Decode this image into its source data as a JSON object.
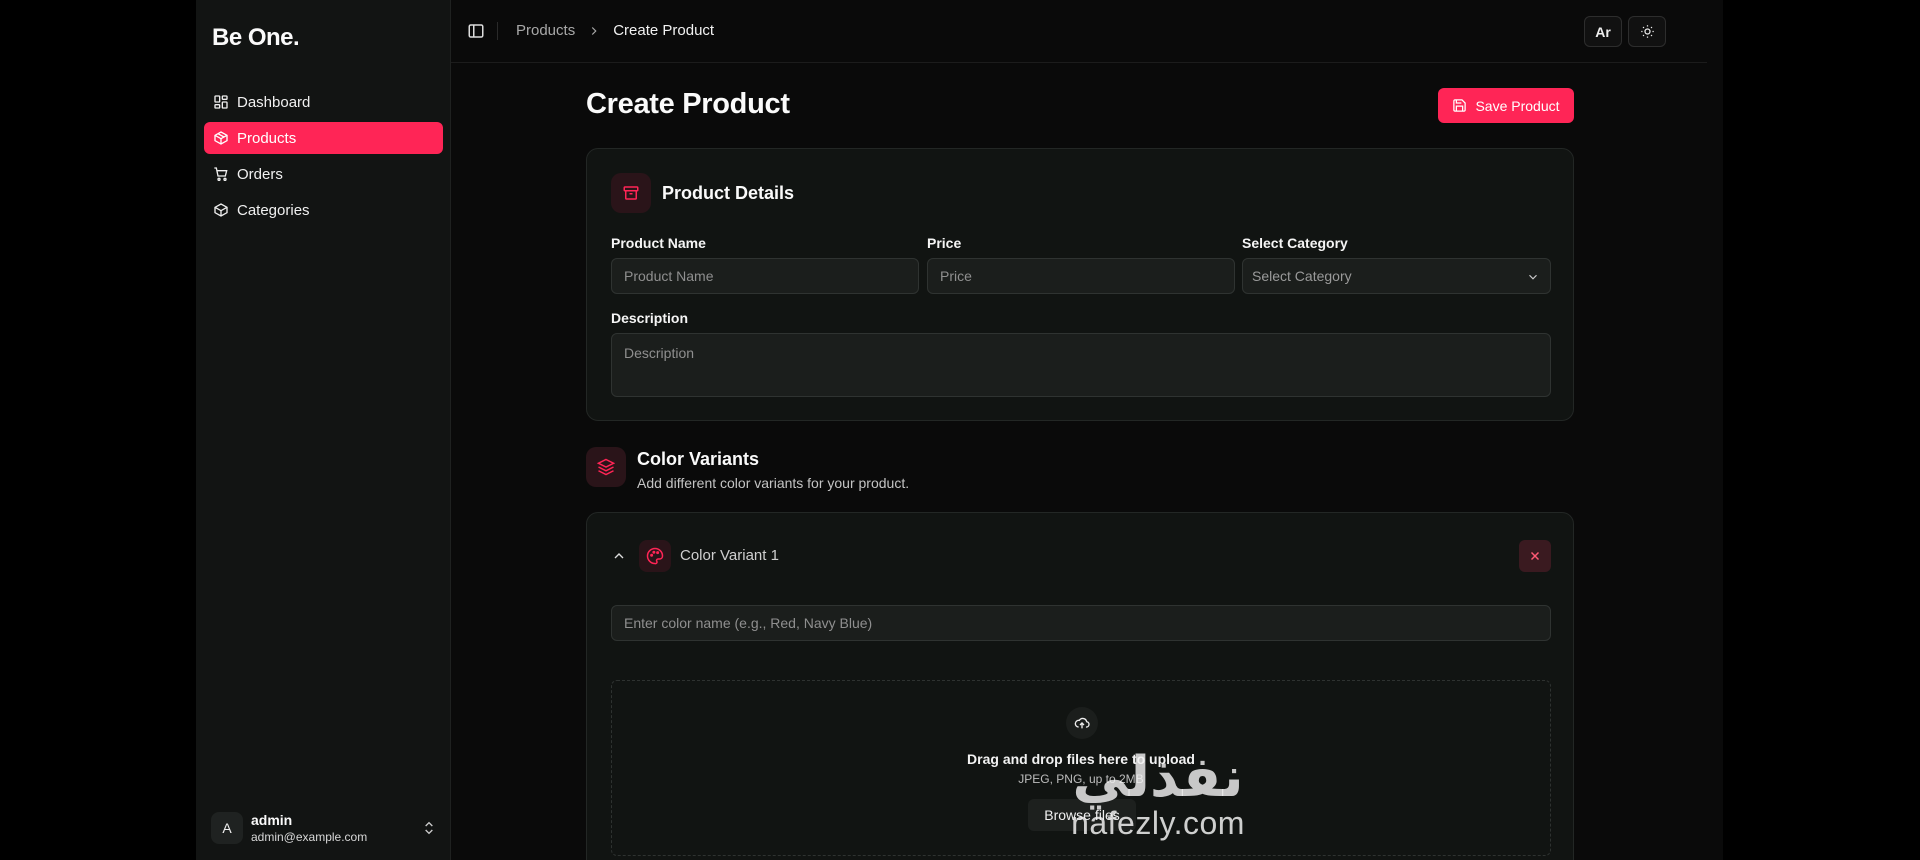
{
  "sidebar": {
    "brand": "Be One.",
    "items": [
      {
        "label": "Dashboard",
        "icon": "dashboard-icon"
      },
      {
        "label": "Products",
        "icon": "package-icon",
        "active": true
      },
      {
        "label": "Orders",
        "icon": "cart-icon"
      },
      {
        "label": "Categories",
        "icon": "box-icon"
      }
    ],
    "user": {
      "initial": "A",
      "name": "admin",
      "email": "admin@example.com"
    }
  },
  "header": {
    "breadcrumb": [
      "Products",
      "Create Product"
    ],
    "lang_button": "Ar",
    "theme_icon": "sun-icon"
  },
  "page": {
    "title": "Create Product",
    "save_label": "Save Product"
  },
  "details": {
    "title": "Product Details",
    "name_label": "Product Name",
    "name_placeholder": "Product Name",
    "price_label": "Price",
    "price_placeholder": "Price",
    "category_label": "Select Category",
    "category_value": "Select Category",
    "description_label": "Description",
    "description_placeholder": "Description"
  },
  "variants": {
    "title": "Color Variants",
    "subtitle": "Add different color variants for your product.",
    "items": [
      {
        "title": "Color Variant 1",
        "color_placeholder": "Enter color name (e.g., Red, Navy Blue)",
        "upload_title": "Drag and drop files here to upload",
        "upload_hint": "JPEG, PNG, up to 2MB",
        "browse_label": "Browse files"
      }
    ]
  },
  "watermark": {
    "arabic": "نفذلي",
    "latin": "nafezly.com"
  },
  "colors": {
    "accent": "#ff2556",
    "background": "#0a0a0a",
    "sidebar": "#121413",
    "card": "#111412"
  }
}
